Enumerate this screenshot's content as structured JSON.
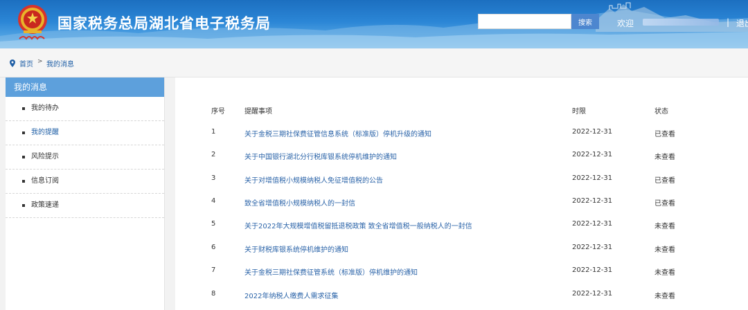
{
  "header": {
    "site_title": "国家税务总局湖北省电子税务局",
    "search": {
      "placeholder": "",
      "button_label": "搜索"
    },
    "welcome_label": "欢迎",
    "separator": "|",
    "logout_label": "退出"
  },
  "breadcrumb": {
    "home": "首页",
    "separator": ">",
    "current": "我的消息"
  },
  "sidebar": {
    "title": "我的消息",
    "items": [
      {
        "label": "我的待办",
        "active": false
      },
      {
        "label": "我的提醒",
        "active": true
      },
      {
        "label": "风险提示",
        "active": false
      },
      {
        "label": "信息订阅",
        "active": false
      },
      {
        "label": "政策速递",
        "active": false
      }
    ]
  },
  "table": {
    "headers": [
      "序号",
      "提醒事项",
      "时限",
      "状态"
    ],
    "rows": [
      {
        "no": "1",
        "title": "关于金税三期社保费征管信息系统（标准版）停机升级的通知",
        "deadline": "2022-12-31",
        "status": "已查看"
      },
      {
        "no": "2",
        "title": "关于中国银行湖北分行税库银系统停机维护的通知",
        "deadline": "2022-12-31",
        "status": "未查看"
      },
      {
        "no": "3",
        "title": "关于对增值税小规模纳税人免征增值税的公告",
        "deadline": "2022-12-31",
        "status": "已查看"
      },
      {
        "no": "4",
        "title": "致全省增值税小规模纳税人的一封信",
        "deadline": "2022-12-31",
        "status": "已查看"
      },
      {
        "no": "5",
        "title": "关于2022年大规模增值税留抵退税政策 致全省增值税一般纳税人的一封信",
        "deadline": "2022-12-31",
        "status": "未查看"
      },
      {
        "no": "6",
        "title": "关于财税库银系统停机维护的通知",
        "deadline": "2022-12-31",
        "status": "未查看"
      },
      {
        "no": "7",
        "title": "关于金税三期社保费征管系统（标准版）停机维护的通知",
        "deadline": "2022-12-31",
        "status": "未查看"
      },
      {
        "no": "8",
        "title": "2022年纳税人缴费人需求征集",
        "deadline": "2022-12-31",
        "status": "未查看"
      }
    ]
  },
  "colors": {
    "header_blue": "#1c6fc0",
    "sidebar_header": "#5da0dc",
    "link": "#2a63a8",
    "search_button": "#4d86cf"
  }
}
